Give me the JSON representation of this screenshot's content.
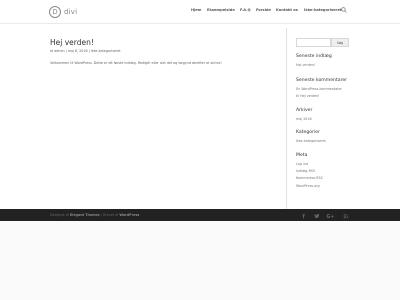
{
  "header": {
    "logo_mark": "D",
    "logo_text": "divi",
    "nav": [
      "Hjem",
      "Eksempelside",
      "F.A.Q",
      "Forside",
      "Kontakt os",
      "Ikke-kategoriseret"
    ]
  },
  "post": {
    "title": "Hej verden!",
    "meta": "af admin | maj 6, 2016 | Ikke-kategoriseret",
    "excerpt": "Velkommen til WordPress. Dette er dit første indlæg. Redigér eller slet det og begynd derefter at skrive!"
  },
  "sidebar": {
    "search_button": "Søg",
    "recent_posts_title": "Seneste indlæg",
    "recent_posts": [
      "Hej verden!"
    ],
    "recent_comments_title": "Seneste kommentarer",
    "recent_comments": [
      "En WordPress-kommentator",
      "til Hej verden!"
    ],
    "archives_title": "Arkiver",
    "archives": [
      "maj 2016"
    ],
    "categories_title": "Kategorier",
    "categories": [
      "Ikke-kategoriseret"
    ],
    "meta_title": "Meta",
    "meta_links": [
      "Log ind",
      "Indlæg-RSS",
      "Kommentar-RSS",
      "WordPress.org"
    ]
  },
  "footer": {
    "designed_by": "Designet af",
    "theme_author": "Elegant Themes",
    "powered_by": "| Drevet af",
    "platform": "WordPress",
    "social_icons": [
      "facebook-icon",
      "twitter-icon",
      "google-plus-icon",
      "rss-icon"
    ]
  },
  "colors": {
    "footer_bg": "#222222",
    "text": "#666666",
    "heading": "#333333"
  }
}
